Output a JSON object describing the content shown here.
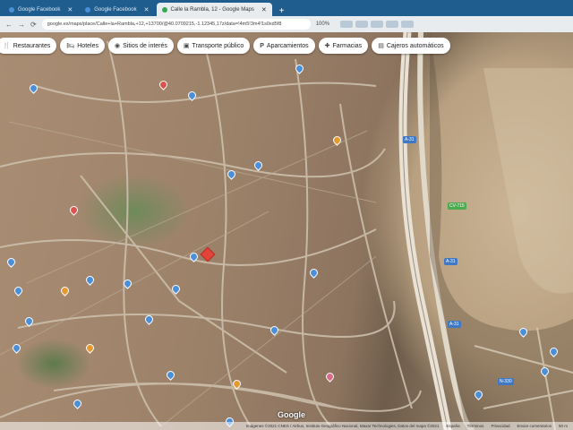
{
  "browser": {
    "tabs": [
      {
        "label": "Google Facebook",
        "active": false
      },
      {
        "label": "Google Facebook",
        "active": false
      },
      {
        "label": "Calle la Rambla, 12 - Google Maps",
        "active": true
      }
    ],
    "url": "google.es/maps/place/Calle+la+Rambla,+12,+13700/@40.0709215,-1.12345,17z/data=!4m5!3m4!1s0xd5f8",
    "zoom": "100%"
  },
  "chips": [
    {
      "icon": "restaurant-icon",
      "label": "Restaurantes"
    },
    {
      "icon": "hotel-icon",
      "label": "Hoteles"
    },
    {
      "icon": "camera-icon",
      "label": "Sitios de interés"
    },
    {
      "icon": "bus-icon",
      "label": "Transporte público"
    },
    {
      "icon": "parking-icon",
      "label": "Aparcamientos"
    },
    {
      "icon": "pharmacy-icon",
      "label": "Farmacias"
    },
    {
      "icon": "atm-icon",
      "label": "Cajeros automáticos"
    }
  ],
  "road_labels": [
    "A-31",
    "A-31",
    "A-31",
    "CV-715",
    "N-330"
  ],
  "footer": {
    "attribution": "Imágenes ©2021 CNES / Airbus, Instituto Geográfico Nacional, Maxar Technologies, Datos del mapa ©2021",
    "country": "España",
    "terms": "Términos",
    "privacy": "Privacidad",
    "feedback": "Enviar comentarios",
    "scale": "50 m"
  },
  "brand": "Google"
}
